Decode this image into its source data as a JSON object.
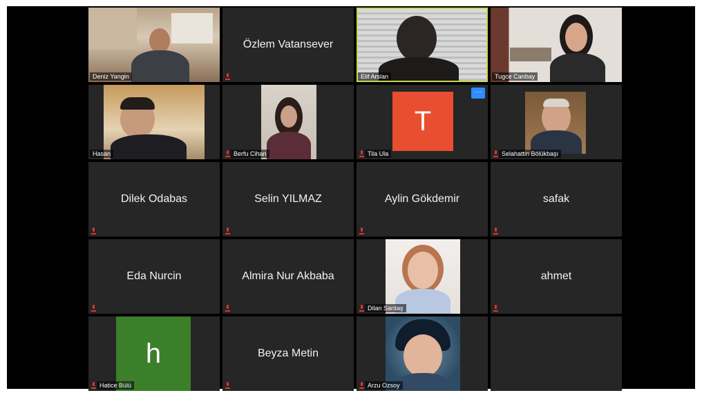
{
  "participants": [
    {
      "name": "Deniz Yangin"
    },
    {
      "name": "Özlem Vatansever"
    },
    {
      "name": "Elif Arslan"
    },
    {
      "name": "Tugce Canbay"
    },
    {
      "name": "Hasan"
    },
    {
      "name": "Berfu Cihan"
    },
    {
      "name": "Tila Ula",
      "avatar_letter": "T"
    },
    {
      "name": "Selahattin Bölükbaşı"
    },
    {
      "name": "Dilek Odabas"
    },
    {
      "name": "Selin YILMAZ"
    },
    {
      "name": "Aylin Gökdemir"
    },
    {
      "name": "safak"
    },
    {
      "name": "Eda Nurcin"
    },
    {
      "name": "Almira Nur Akbaba"
    },
    {
      "name": "Dilan Sarıtaş"
    },
    {
      "name": "ahmet"
    },
    {
      "name": "Hatice Bülü",
      "avatar_letter": "h"
    },
    {
      "name": "Beyza Metin"
    },
    {
      "name": "Arzu Ozsoy"
    }
  ],
  "more_button": "···",
  "colors": {
    "active_border": "#c8d850",
    "muted_icon": "#e0352b",
    "tila_avatar": "#e84e2f",
    "hatice_avatar": "#3b7f2a",
    "more_button": "#2d8cff"
  }
}
